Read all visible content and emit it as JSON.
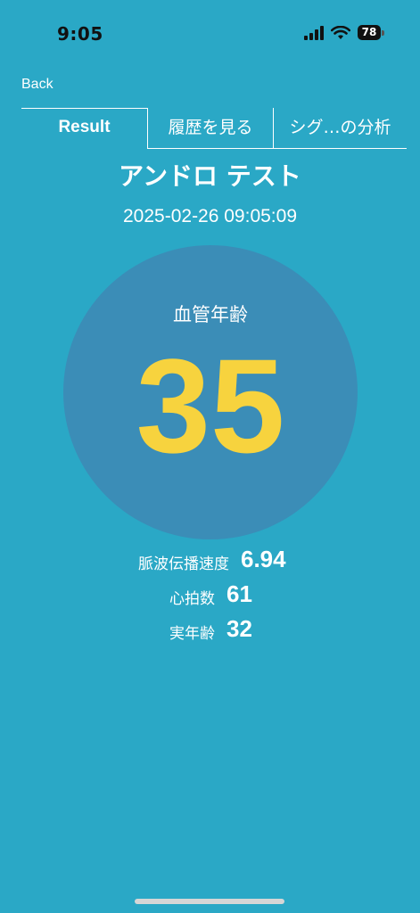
{
  "status_bar": {
    "time": "9:05",
    "battery": "78",
    "icons": [
      "signal-icon",
      "wifi-icon",
      "battery-icon"
    ]
  },
  "nav": {
    "back_label": "Back"
  },
  "tabs": [
    {
      "label": "Result",
      "active": true
    },
    {
      "label": "履歴を見る",
      "active": false
    },
    {
      "label": "シグ…の分析",
      "active": false
    }
  ],
  "header": {
    "title": "アンドロ テスト",
    "timestamp": "2025-02-26 09:05:09"
  },
  "result": {
    "label": "血管年齢",
    "value": "35"
  },
  "stats": [
    {
      "label": "脈波伝播速度",
      "value": "6.94"
    },
    {
      "label": "心拍数",
      "value": "61"
    },
    {
      "label": "実年齢",
      "value": "32"
    }
  ],
  "colors": {
    "background": "#2aa8c6",
    "circle": "#3b8db7",
    "accent": "#f7d33e",
    "text": "#ffffff"
  }
}
